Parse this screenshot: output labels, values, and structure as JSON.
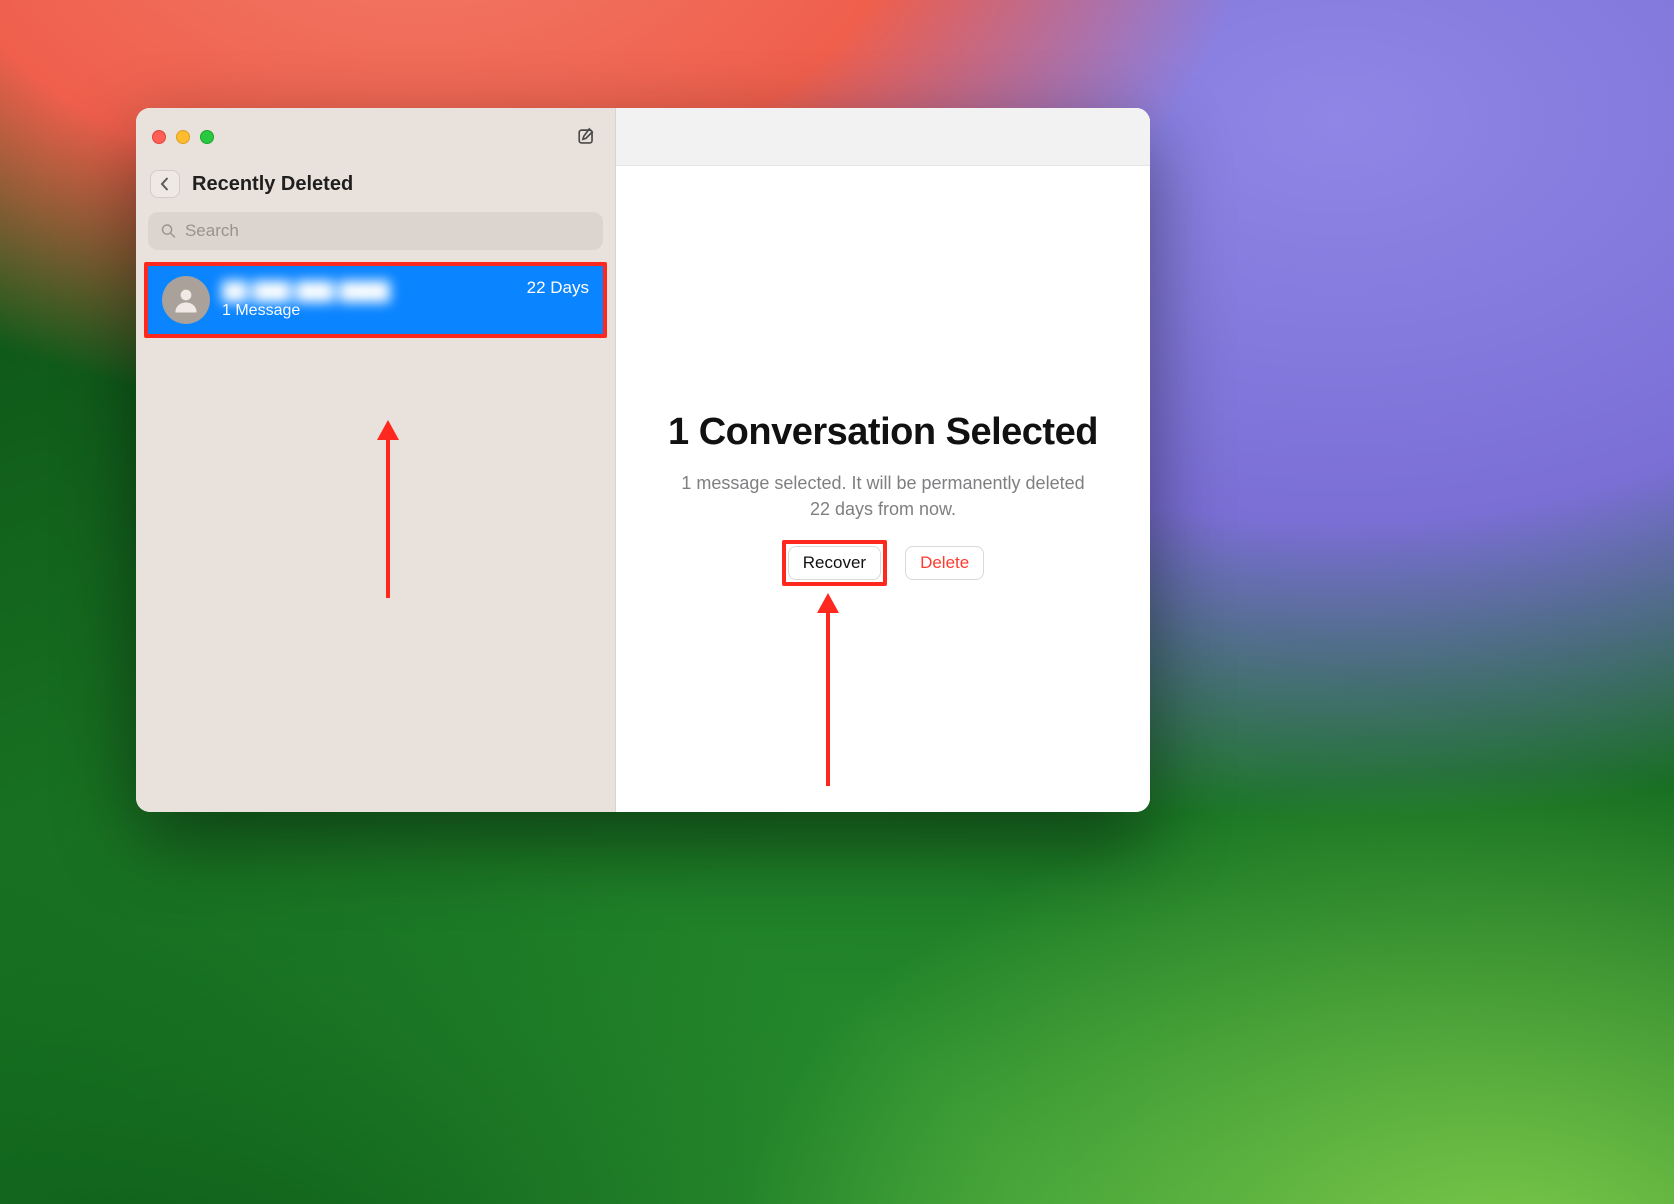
{
  "sidebar": {
    "title": "Recently Deleted",
    "search_placeholder": "Search",
    "conversations": [
      {
        "name": "██ ███ ███ ████",
        "subtitle": "1 Message",
        "days_label": "22 Days"
      }
    ]
  },
  "content": {
    "title": "1 Conversation Selected",
    "description": "1 message selected. It will be permanently deleted 22 days from now.",
    "recover_label": "Recover",
    "delete_label": "Delete"
  }
}
